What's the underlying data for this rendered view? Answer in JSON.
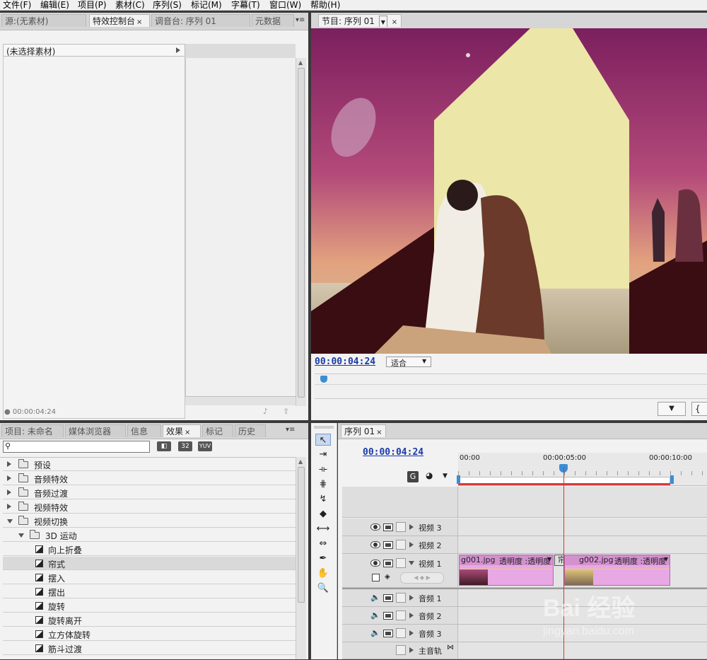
{
  "menu": [
    "文件(F)",
    "编辑(E)",
    "项目(P)",
    "素材(C)",
    "序列(S)",
    "标记(M)",
    "字幕(T)",
    "窗口(W)",
    "帮助(H)"
  ],
  "source_panel": {
    "tabs": [
      "源:(无素材)",
      "特效控制台",
      "调音台: 序列 01",
      "元数据"
    ],
    "no_clip": "(未选择素材)",
    "timecode": "00:00:04:24"
  },
  "program": {
    "tab": "节目: 序列 01",
    "timecode": "00:00:04:24",
    "fit": "适合"
  },
  "effects_panel": {
    "tabs": [
      "项目: 未命名",
      "媒体浏览器",
      "信息",
      "效果",
      "标记",
      "历史"
    ],
    "search_value": "",
    "badges": [
      "32",
      "YUV"
    ],
    "items": [
      {
        "label": "预设",
        "kind": "folder",
        "level": 0,
        "open": false
      },
      {
        "label": "音频特效",
        "kind": "folder",
        "level": 0,
        "open": false
      },
      {
        "label": "音频过渡",
        "kind": "folder",
        "level": 0,
        "open": false
      },
      {
        "label": "视频特效",
        "kind": "folder",
        "level": 0,
        "open": false
      },
      {
        "label": "视频切换",
        "kind": "folder",
        "level": 0,
        "open": true
      },
      {
        "label": "3D 运动",
        "kind": "folder",
        "level": 1,
        "open": true
      },
      {
        "label": "向上折叠",
        "kind": "transition",
        "level": 2
      },
      {
        "label": "帘式",
        "kind": "transition",
        "level": 2,
        "selected": true
      },
      {
        "label": "摆入",
        "kind": "transition",
        "level": 2
      },
      {
        "label": "摆出",
        "kind": "transition",
        "level": 2
      },
      {
        "label": "旋转",
        "kind": "transition",
        "level": 2
      },
      {
        "label": "旋转离开",
        "kind": "transition",
        "level": 2
      },
      {
        "label": "立方体旋转",
        "kind": "transition",
        "level": 2
      },
      {
        "label": "筋斗过渡",
        "kind": "transition",
        "level": 2
      }
    ]
  },
  "timeline": {
    "tab": "序列 01",
    "timecode": "00:00:04:24",
    "ruler": [
      "00:00",
      "00:00:05:00",
      "00:00:10:00"
    ],
    "video_tracks": [
      "视频 3",
      "视频 2",
      "视频 1"
    ],
    "audio_tracks": [
      "音频 1",
      "音频 2",
      "音频 3"
    ],
    "master": "主音轨",
    "clips": [
      {
        "name": "g001.jpg",
        "effect": "透明度 :透明度"
      },
      {
        "name": "g002.jpg",
        "effect": "透明度 :透明度"
      }
    ],
    "transition_label": "帘式"
  },
  "watermark": {
    "brand": "Bai 经验",
    "url": "jingyan.baidu.com"
  },
  "colors": {
    "timecode": "#1a3aa8",
    "clip": "#e7a8e3",
    "clip_border": "#b06aad",
    "playhead": "#d0382e",
    "workarea": "#d63a3a"
  }
}
